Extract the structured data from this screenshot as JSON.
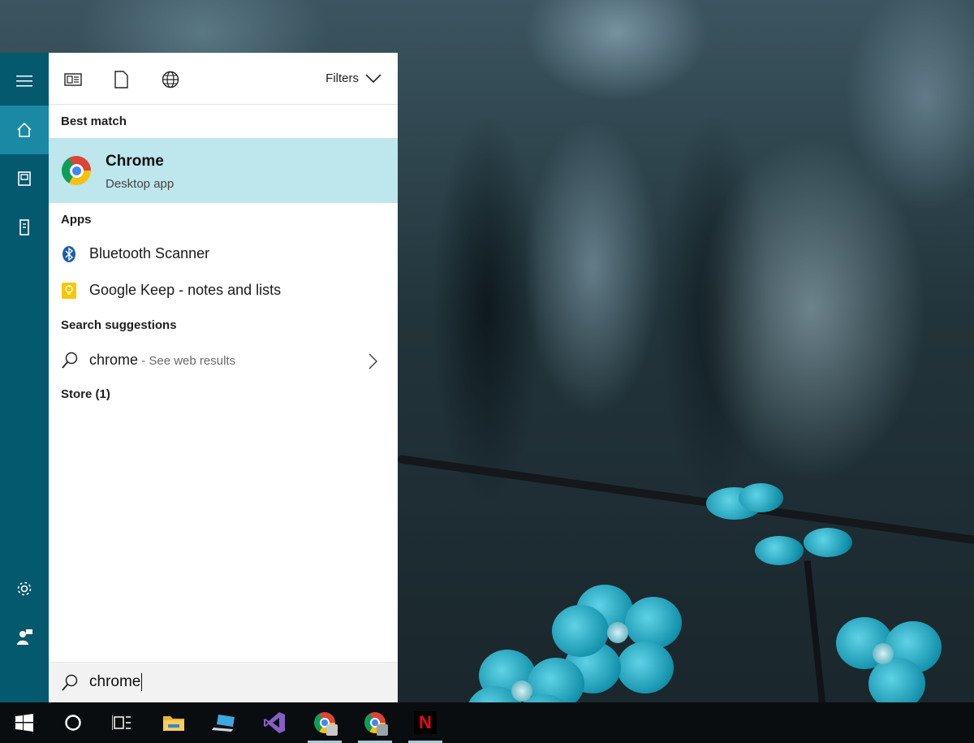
{
  "search_panel": {
    "filters_label": "Filters",
    "best_match": {
      "heading": "Best match",
      "title": "Chrome",
      "subtitle": "Desktop app"
    },
    "apps": {
      "heading": "Apps",
      "items": [
        {
          "label": "Bluetooth Scanner",
          "icon": "bluetooth-icon"
        },
        {
          "label": "Google Keep - notes and lists",
          "icon": "keep-icon"
        }
      ]
    },
    "suggestions": {
      "heading": "Search suggestions",
      "query": "chrome",
      "hint": " - See web results"
    },
    "store": {
      "heading": "Store (1)"
    },
    "search_box": {
      "value": "chrome"
    }
  },
  "rail_icons": [
    "hamburger-icon",
    "home-icon",
    "documents-icon",
    "device-icon",
    "settings-icon",
    "feedback-icon"
  ],
  "taskbar_icons": [
    "windows-icon",
    "cortana-icon",
    "task-view-icon",
    "file-explorer-icon",
    "this-pc-icon",
    "visual-studio-icon",
    "chrome-icon",
    "chrome-icon",
    "netflix-icon"
  ],
  "colors": {
    "rail": "#05596e",
    "rail_active": "#1a8aa4",
    "best_match_bg": "#bde6ed",
    "taskbar": "#0a0d0f"
  },
  "netflix_letter": "N"
}
